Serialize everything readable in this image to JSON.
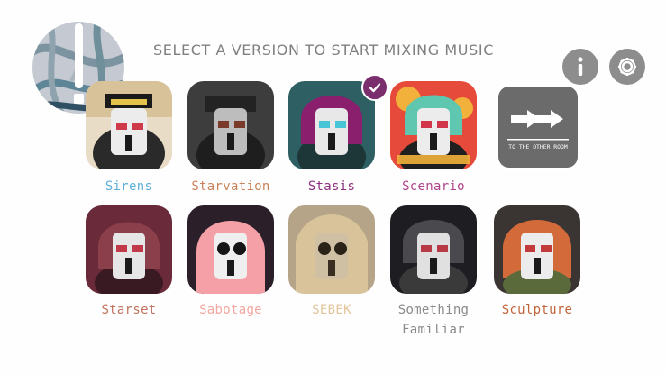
{
  "header": {
    "title": "SELECT A VERSION TO START MIXING MUSIC",
    "info_icon": "info-icon",
    "settings_icon": "gear-icon"
  },
  "versions_row1": [
    {
      "label": "Sirens",
      "color": "#5fb0d6"
    },
    {
      "label": "Starvation",
      "color": "#c9835a"
    },
    {
      "label": "Stasis",
      "color": "#8e2f7e",
      "selected": true
    },
    {
      "label": "Scenario",
      "color": "#b0448a"
    },
    {
      "label": "TO THE OTHER ROOM",
      "color": "#6b6b6b"
    }
  ],
  "versions_row2": [
    {
      "label": "Starset",
      "color": "#c2735e"
    },
    {
      "label": "Sabotage",
      "color": "#f3a7a0"
    },
    {
      "label": "SEBEK",
      "color": "#e2c59a"
    },
    {
      "label": "Something",
      "label2": "Familiar",
      "color": "#8a8a8a"
    },
    {
      "label": "Sculpture",
      "color": "#c0643a"
    }
  ],
  "colors": {
    "background": "#fefefe",
    "button_gray": "#8d8d8d",
    "check_badge": "#7a2e6e"
  }
}
